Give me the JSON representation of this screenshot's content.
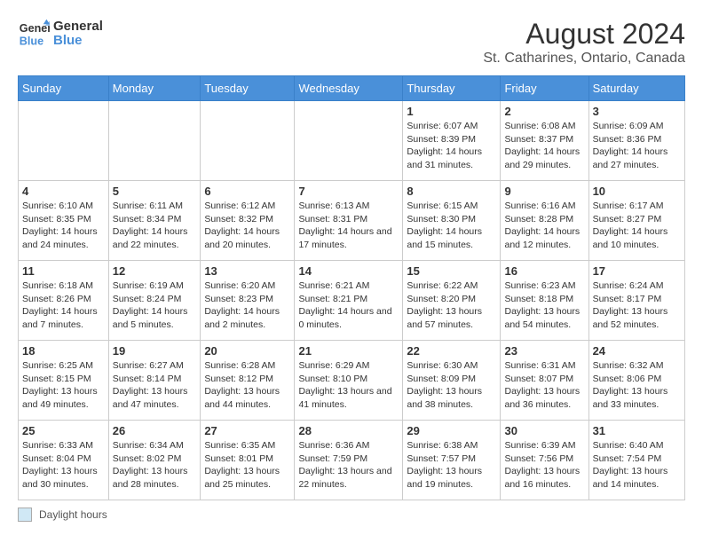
{
  "logo": {
    "line1": "General",
    "line2": "Blue"
  },
  "title": "August 2024",
  "subtitle": "St. Catharines, Ontario, Canada",
  "headers": [
    "Sunday",
    "Monday",
    "Tuesday",
    "Wednesday",
    "Thursday",
    "Friday",
    "Saturday"
  ],
  "legend_label": "Daylight hours",
  "weeks": [
    [
      {
        "day": "",
        "info": ""
      },
      {
        "day": "",
        "info": ""
      },
      {
        "day": "",
        "info": ""
      },
      {
        "day": "",
        "info": ""
      },
      {
        "day": "1",
        "info": "Sunrise: 6:07 AM\nSunset: 8:39 PM\nDaylight: 14 hours and 31 minutes."
      },
      {
        "day": "2",
        "info": "Sunrise: 6:08 AM\nSunset: 8:37 PM\nDaylight: 14 hours and 29 minutes."
      },
      {
        "day": "3",
        "info": "Sunrise: 6:09 AM\nSunset: 8:36 PM\nDaylight: 14 hours and 27 minutes."
      }
    ],
    [
      {
        "day": "4",
        "info": "Sunrise: 6:10 AM\nSunset: 8:35 PM\nDaylight: 14 hours and 24 minutes."
      },
      {
        "day": "5",
        "info": "Sunrise: 6:11 AM\nSunset: 8:34 PM\nDaylight: 14 hours and 22 minutes."
      },
      {
        "day": "6",
        "info": "Sunrise: 6:12 AM\nSunset: 8:32 PM\nDaylight: 14 hours and 20 minutes."
      },
      {
        "day": "7",
        "info": "Sunrise: 6:13 AM\nSunset: 8:31 PM\nDaylight: 14 hours and 17 minutes."
      },
      {
        "day": "8",
        "info": "Sunrise: 6:15 AM\nSunset: 8:30 PM\nDaylight: 14 hours and 15 minutes."
      },
      {
        "day": "9",
        "info": "Sunrise: 6:16 AM\nSunset: 8:28 PM\nDaylight: 14 hours and 12 minutes."
      },
      {
        "day": "10",
        "info": "Sunrise: 6:17 AM\nSunset: 8:27 PM\nDaylight: 14 hours and 10 minutes."
      }
    ],
    [
      {
        "day": "11",
        "info": "Sunrise: 6:18 AM\nSunset: 8:26 PM\nDaylight: 14 hours and 7 minutes."
      },
      {
        "day": "12",
        "info": "Sunrise: 6:19 AM\nSunset: 8:24 PM\nDaylight: 14 hours and 5 minutes."
      },
      {
        "day": "13",
        "info": "Sunrise: 6:20 AM\nSunset: 8:23 PM\nDaylight: 14 hours and 2 minutes."
      },
      {
        "day": "14",
        "info": "Sunrise: 6:21 AM\nSunset: 8:21 PM\nDaylight: 14 hours and 0 minutes."
      },
      {
        "day": "15",
        "info": "Sunrise: 6:22 AM\nSunset: 8:20 PM\nDaylight: 13 hours and 57 minutes."
      },
      {
        "day": "16",
        "info": "Sunrise: 6:23 AM\nSunset: 8:18 PM\nDaylight: 13 hours and 54 minutes."
      },
      {
        "day": "17",
        "info": "Sunrise: 6:24 AM\nSunset: 8:17 PM\nDaylight: 13 hours and 52 minutes."
      }
    ],
    [
      {
        "day": "18",
        "info": "Sunrise: 6:25 AM\nSunset: 8:15 PM\nDaylight: 13 hours and 49 minutes."
      },
      {
        "day": "19",
        "info": "Sunrise: 6:27 AM\nSunset: 8:14 PM\nDaylight: 13 hours and 47 minutes."
      },
      {
        "day": "20",
        "info": "Sunrise: 6:28 AM\nSunset: 8:12 PM\nDaylight: 13 hours and 44 minutes."
      },
      {
        "day": "21",
        "info": "Sunrise: 6:29 AM\nSunset: 8:10 PM\nDaylight: 13 hours and 41 minutes."
      },
      {
        "day": "22",
        "info": "Sunrise: 6:30 AM\nSunset: 8:09 PM\nDaylight: 13 hours and 38 minutes."
      },
      {
        "day": "23",
        "info": "Sunrise: 6:31 AM\nSunset: 8:07 PM\nDaylight: 13 hours and 36 minutes."
      },
      {
        "day": "24",
        "info": "Sunrise: 6:32 AM\nSunset: 8:06 PM\nDaylight: 13 hours and 33 minutes."
      }
    ],
    [
      {
        "day": "25",
        "info": "Sunrise: 6:33 AM\nSunset: 8:04 PM\nDaylight: 13 hours and 30 minutes."
      },
      {
        "day": "26",
        "info": "Sunrise: 6:34 AM\nSunset: 8:02 PM\nDaylight: 13 hours and 28 minutes."
      },
      {
        "day": "27",
        "info": "Sunrise: 6:35 AM\nSunset: 8:01 PM\nDaylight: 13 hours and 25 minutes."
      },
      {
        "day": "28",
        "info": "Sunrise: 6:36 AM\nSunset: 7:59 PM\nDaylight: 13 hours and 22 minutes."
      },
      {
        "day": "29",
        "info": "Sunrise: 6:38 AM\nSunset: 7:57 PM\nDaylight: 13 hours and 19 minutes."
      },
      {
        "day": "30",
        "info": "Sunrise: 6:39 AM\nSunset: 7:56 PM\nDaylight: 13 hours and 16 minutes."
      },
      {
        "day": "31",
        "info": "Sunrise: 6:40 AM\nSunset: 7:54 PM\nDaylight: 13 hours and 14 minutes."
      }
    ]
  ]
}
